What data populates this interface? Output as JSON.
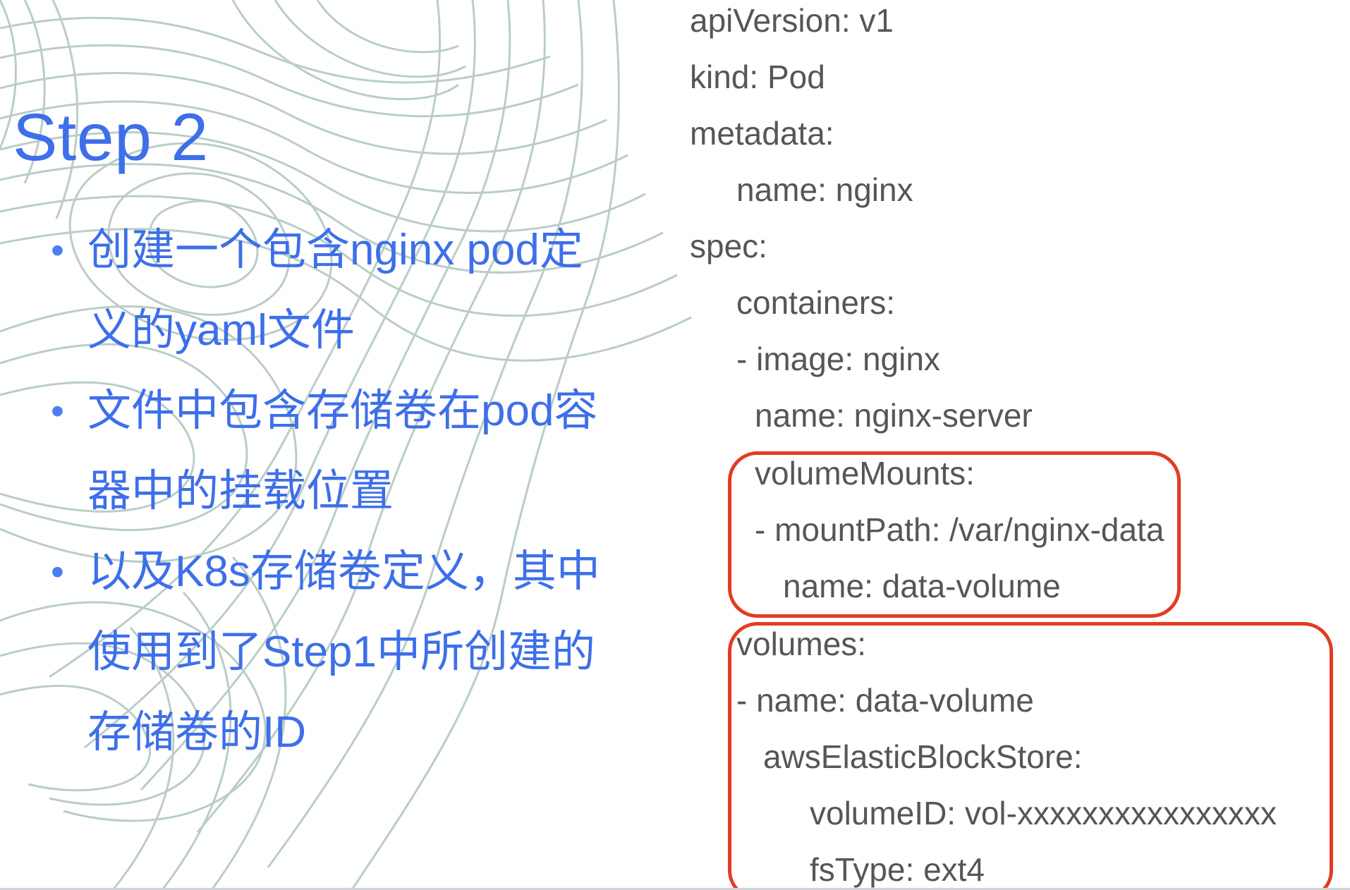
{
  "slide": {
    "title": "Step 2",
    "bullets": [
      {
        "lines": [
          "创建一个包含nginx pod定",
          "义的yaml文件"
        ]
      },
      {
        "lines": [
          "文件中包含存储卷在pod容",
          "器中的挂载位置"
        ]
      },
      {
        "lines": [
          "以及K8s存储卷定义，其中",
          "使用到了Step1中所创建的",
          "存储卷的ID"
        ]
      }
    ],
    "bullet_symbol": "•"
  },
  "yaml_code": {
    "lines": [
      "apiVersion: v1",
      "kind: Pod",
      "metadata:",
      "name: nginx",
      "spec:",
      "containers:",
      "- image: nginx",
      "name: nginx-server",
      "volumeMounts:",
      "- mountPath: /var/nginx-data",
      "name: data-volume",
      "volumes:",
      "- name: data-volume",
      "awsElasticBlockStore:",
      "volumeID: vol-xxxxxxxxxxxxxxxx",
      "fsType: ext4"
    ]
  },
  "colors": {
    "title": "#3d6fe9",
    "bullets": "#3d6fe9",
    "code_text": "#565656",
    "highlight_border": "#e23c22",
    "background_lines": "#b7cbc4"
  }
}
